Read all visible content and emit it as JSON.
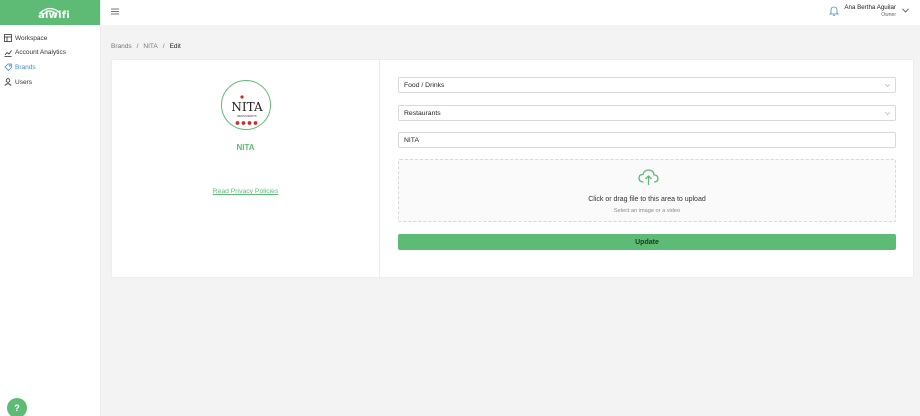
{
  "app": {
    "logo_text": "aiwifi",
    "brand_color": "#5dbb75"
  },
  "sidebar": {
    "items": [
      {
        "label": "Workspace",
        "icon": "workspace-icon"
      },
      {
        "label": "Account Analytics",
        "icon": "analytics-icon"
      },
      {
        "label": "Brands",
        "icon": "brands-icon",
        "active": true
      },
      {
        "label": "Users",
        "icon": "user-icon"
      }
    ]
  },
  "topbar": {
    "user_name": "Ana Bertha Aguilar",
    "user_role": "Owner",
    "icons": [
      "menu-toggle-icon",
      "bell-icon",
      "chevron-down-icon"
    ]
  },
  "breadcrumb": {
    "items": [
      "Brands",
      "NITA",
      "Edit"
    ],
    "separator": "/"
  },
  "brand": {
    "logo_text": "NITA",
    "logo_subtext": "RESTAURANTS",
    "name": "NITA",
    "privacy_link": "Read Privacy Policies"
  },
  "form": {
    "category_value": "Food / Drinks",
    "subcategory_value": "Restaurants",
    "name_value": "NITA",
    "upload_title": "Click or drag file to this area to upload",
    "upload_hint": "Select an image or a video",
    "submit_label": "Update"
  },
  "help": {
    "label": "?"
  }
}
